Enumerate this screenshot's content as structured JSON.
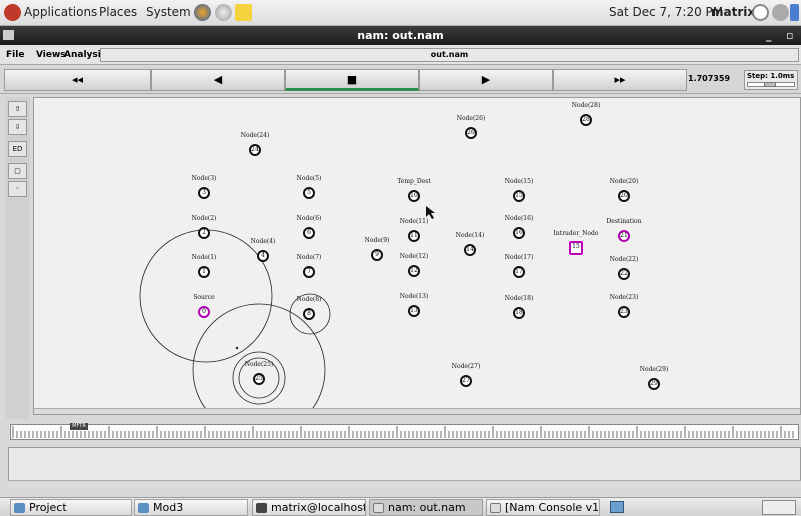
{
  "top_panel": {
    "applications": "Applications",
    "places": "Places",
    "system": "System",
    "datetime": "Sat Dec  7,  7:20 PM",
    "user": "matrix"
  },
  "window": {
    "title": "nam: out.nam",
    "menu": [
      "File",
      "Views",
      "Analysis"
    ],
    "file_field": "out.nam"
  },
  "toolbar": {
    "rewind": "◂◂",
    "back": "◀",
    "stop": "■",
    "play": "▶",
    "fast_forward": "▸▸",
    "time": "1.707359",
    "step": "Step: 1.0ms"
  },
  "left_tools": [
    "⇧",
    "⇩",
    "ED",
    "▢",
    "◦"
  ],
  "nodes": [
    {
      "label": "Node(24)",
      "id": "24"
    },
    {
      "label": "Node(26)",
      "id": "26"
    },
    {
      "label": "Node(28)",
      "id": "28"
    },
    {
      "label": "Node(3)",
      "id": "3"
    },
    {
      "label": "Node(5)",
      "id": "5"
    },
    {
      "label": "Temp_Dest",
      "id": "10"
    },
    {
      "label": "Node(15)",
      "id": "15"
    },
    {
      "label": "Node(20)",
      "id": "20"
    },
    {
      "label": "Node(2)",
      "id": "2"
    },
    {
      "label": "Node(6)",
      "id": "6"
    },
    {
      "label": "Node(11)",
      "id": "11"
    },
    {
      "label": "Node(16)",
      "id": "16"
    },
    {
      "label": "Node(14)",
      "id": "14"
    },
    {
      "label": "Intruder_Node",
      "id": "15"
    },
    {
      "label": "Destination",
      "id": "21"
    },
    {
      "label": "Node(4)",
      "id": "4"
    },
    {
      "label": "Node(9)",
      "id": "9"
    },
    {
      "label": "Node(1)",
      "id": "1"
    },
    {
      "label": "Node(7)",
      "id": "7"
    },
    {
      "label": "Node(12)",
      "id": "12"
    },
    {
      "label": "Node(17)",
      "id": "17"
    },
    {
      "label": "Node(22)",
      "id": "22"
    },
    {
      "label": "Source",
      "id": "0"
    },
    {
      "label": "Node(8)",
      "id": "8"
    },
    {
      "label": "Node(13)",
      "id": "13"
    },
    {
      "label": "Node(18)",
      "id": "18"
    },
    {
      "label": "Node(23)",
      "id": "23"
    },
    {
      "label": "Node(25)",
      "id": "25"
    },
    {
      "label": "Node(27)",
      "id": "27"
    },
    {
      "label": "Node(29)",
      "id": "29"
    }
  ],
  "ruler_marker": "MFTR",
  "taskbar": [
    "Project",
    "Mod3",
    "matrix@localhost:~/D...",
    "nam: out.nam",
    "[Nam Console v1.14]"
  ]
}
